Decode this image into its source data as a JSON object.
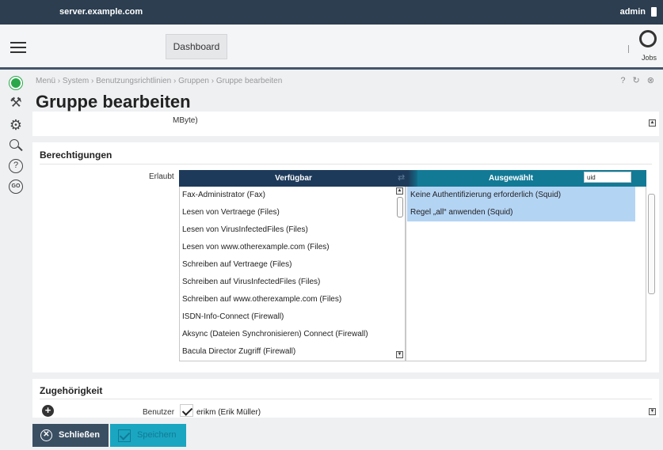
{
  "topbar": {
    "hostname": "server.example.com",
    "user": "admin"
  },
  "navbar": {
    "dashboard_label": "Dashboard",
    "jobs_label": "Jobs"
  },
  "breadcrumb": "Menü › System › Benutzungsrichtlinien › Gruppen › Gruppe bearbeiten",
  "page_title": "Gruppe bearbeiten",
  "top_icons": "? ↻ ⊗",
  "mbyte_card": {
    "label": "MByte)"
  },
  "permissions": {
    "title": "Berechtigungen",
    "field_label": "Erlaubt",
    "available_header": "Verfügbar",
    "selected_header": "Ausgewählt",
    "filter_value": "uid",
    "available_items": [
      "Fax-Administrator (Fax)",
      "Lesen von Vertraege (Files)",
      "Lesen von VirusInfectedFiles (Files)",
      "Lesen von www.otherexample.com (Files)",
      "Schreiben auf Vertraege (Files)",
      "Schreiben auf VirusInfectedFiles (Files)",
      "Schreiben auf www.otherexample.com (Files)",
      "ISDN-Info-Connect (Firewall)",
      "Aksync (Dateien Synchronisieren) Connect (Firewall)",
      "Bacula Director Zugriff (Firewall)"
    ],
    "selected_items": [
      "Keine Authentifizierung erforderlich (Squid)",
      "Regel „all“ anwenden (Squid)"
    ]
  },
  "membership": {
    "title": "Zugehörigkeit",
    "user_label": "Benutzer",
    "user_entry": "erikm (Erik Müller)"
  },
  "buttons": {
    "close_label": "Schließen",
    "save_label": "Speichern"
  },
  "colors": {
    "topbar": "#2c3e50",
    "available_header": "#1e3a5a",
    "selected_header": "#137a96",
    "selected_row": "#b4d4f4",
    "save_button": "#1aa6c0",
    "close_button": "#3b4f63",
    "status_ok": "#2aa84a"
  }
}
